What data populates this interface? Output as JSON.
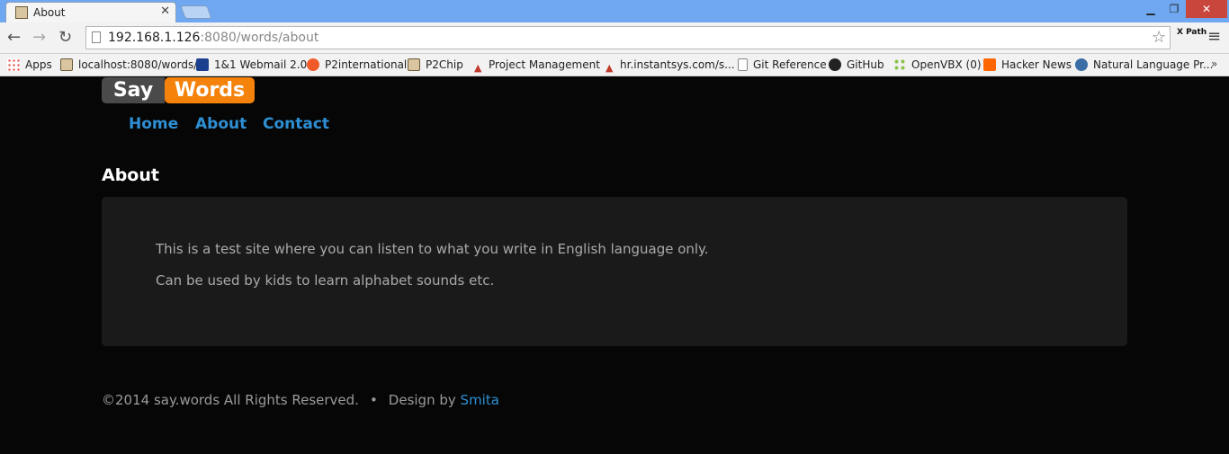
{
  "browser": {
    "tab_title": "About",
    "url_host": "192.168.1.126",
    "url_rest": ":8080/words/about",
    "xpath_label": "X Path",
    "bookmarks": [
      {
        "label": "Apps",
        "icon": "apps-grid-icon"
      },
      {
        "label": "localhost:8080/words/",
        "icon": "image-favicon-icon"
      },
      {
        "label": "1&1 Webmail 2.0",
        "icon": "webmail-icon"
      },
      {
        "label": "P2international",
        "icon": "p2-icon"
      },
      {
        "label": "P2Chip",
        "icon": "image-favicon-icon"
      },
      {
        "label": "Project Management",
        "icon": "pin-icon"
      },
      {
        "label": "hr.instantsys.com/s...",
        "icon": "pin-icon"
      },
      {
        "label": "Git Reference",
        "icon": "document-icon"
      },
      {
        "label": "GitHub",
        "icon": "github-icon"
      },
      {
        "label": "OpenVBX (0)",
        "icon": "openvbx-icon"
      },
      {
        "label": "Hacker News",
        "icon": "hacker-news-icon"
      },
      {
        "label": "Natural Language Pr...",
        "icon": "globe-icon"
      }
    ]
  },
  "site": {
    "logo_say": "Say",
    "logo_words": "Words",
    "nav": [
      "Home",
      "About",
      "Contact"
    ],
    "page_title": "About",
    "paragraphs": [
      "This is a test site where you can listen to what you write in English language only.",
      "Can be used by kids to learn alphabet sounds etc."
    ],
    "footer": {
      "copyright": "©2014 say.words All Rights Reserved.",
      "separator": "•",
      "design_by": "Design by",
      "designer": "Smita"
    }
  },
  "colors": {
    "page_bg": "#060606",
    "content_bg": "#1a1a1a",
    "accent_orange": "#f5820a",
    "link_blue": "#2e8fd3"
  }
}
